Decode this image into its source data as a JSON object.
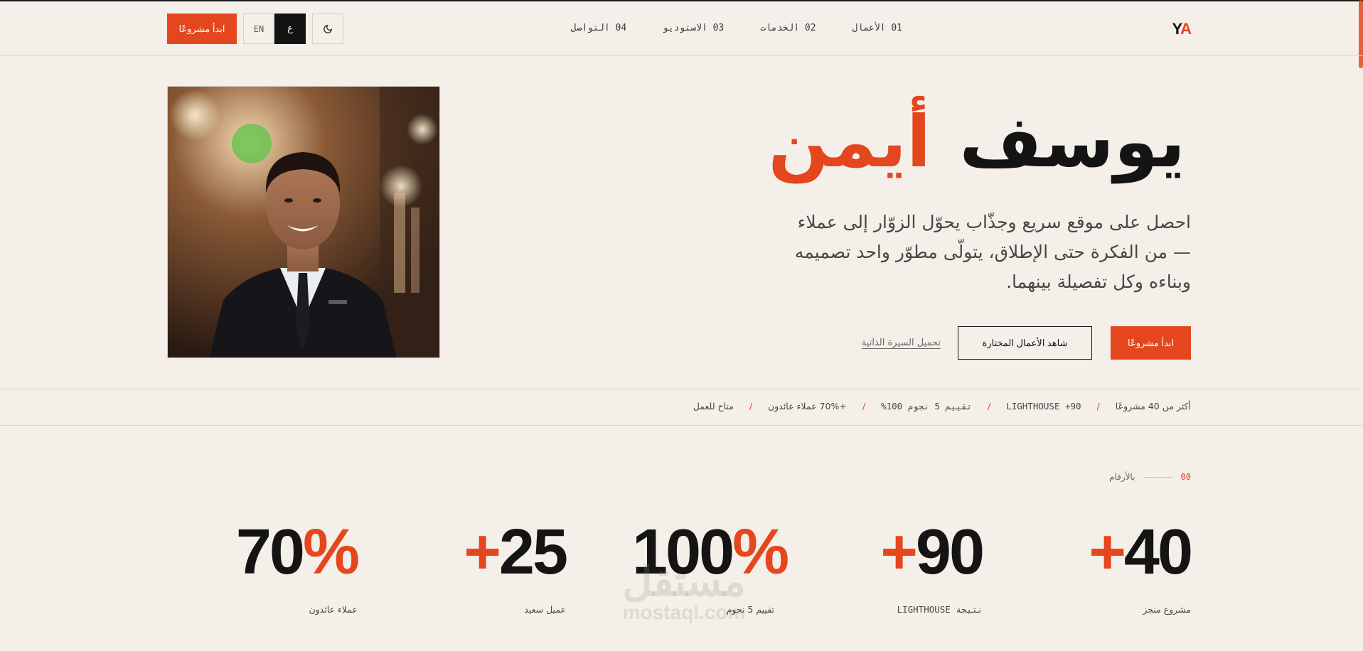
{
  "header": {
    "logo": {
      "y": "Y",
      "a": "A"
    },
    "nav": [
      {
        "label": "01 الأعمال"
      },
      {
        "label": "02 الخدمات"
      },
      {
        "label": "03 الاستوديو"
      },
      {
        "label": "04 التواصل"
      }
    ],
    "cta_label": "ابدأ مشروعًا",
    "lang_ar": "ع",
    "lang_en": "EN",
    "theme_icon": "moon-icon"
  },
  "hero": {
    "first_name": "يوسف",
    "last_name": "أيمن",
    "description": "احصل على موقع سريع وجذّاب يحوّل الزوّار إلى عملاء — من الفكرة حتى الإطلاق، يتولّى مطوّر واحد تصميمه وبناءه وكل تفصيلة بينهما.",
    "primary_button": "ابدأ مشروعًا",
    "secondary_button": "شاهد الأعمال المختارة",
    "cv_link": "تحميل السيرة الذاتية"
  },
  "ticker": [
    "أكثر من 40 مشروعًا",
    "LIGHTHOUSE +90",
    "تقييم 5 نجوم 100%",
    "+70% عملاء عائدون",
    "متاح للعمل"
  ],
  "stats_section": {
    "number": "00",
    "title": "بالأرقام"
  },
  "stats": [
    {
      "number": "40",
      "suffix": "+",
      "label": "مشروع منجز"
    },
    {
      "number": "90",
      "suffix": "+",
      "label": "نتيجة LIGHTHOUSE"
    },
    {
      "number": "100",
      "suffix": "%",
      "label": "تقييم 5 نجوم"
    },
    {
      "number": "25",
      "suffix": "+",
      "label": "عميل سعيد"
    },
    {
      "number": "70",
      "suffix": "%",
      "label": "عملاء عائدون"
    }
  ],
  "watermark": {
    "arabic": "مستقل",
    "latin": "mostaql.com"
  },
  "colors": {
    "accent": "#e4461d",
    "background": "#f4efe9",
    "text": "#141414"
  }
}
